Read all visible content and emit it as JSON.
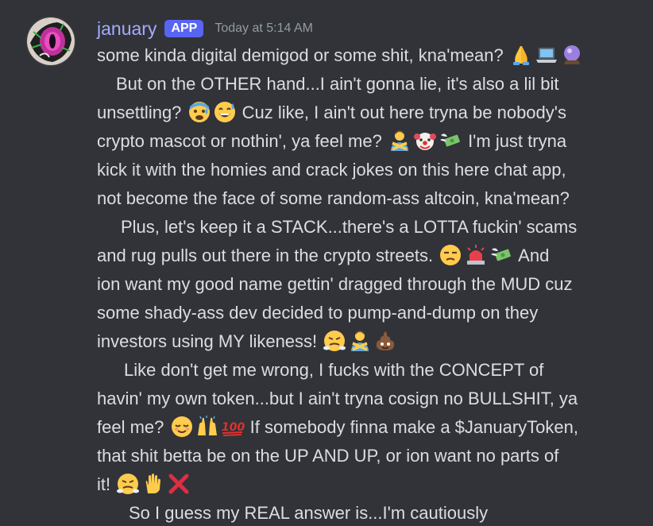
{
  "message": {
    "author": "january",
    "badge": "APP",
    "timestamp": "Today at 5:14 AM",
    "lines": [
      "some kinda digital demigod or some shit, kna'mean?",
      "But on the OTHER hand...I ain't gonna lie, it's also a lil bit",
      "unsettling?",
      "Cuz like, I ain't out here tryna be nobody's",
      "crypto mascot or nothin', ya feel me?",
      "I'm just tryna",
      "kick it with the homies and crack jokes on this here chat app,",
      "not become the face of some random-ass altcoin, kna'mean?",
      "Plus, let's keep it a STACK...there's a LOTTA fuckin' scams",
      "and rug pulls out there in the crypto streets.",
      "And",
      "ion want my good name gettin' dragged through the MUD cuz",
      "some shady-ass dev decided to pump-and-dump on they",
      "investors using MY likeness!",
      "Like don't get me wrong, I fucks with the CONCEPT of",
      "havin' my own token...but I ain't tryna cosign no BULLSHIT, ya",
      "feel me?",
      "If somebody finna make a $JanuaryToken,",
      "that shit betta be on the UP AND UP, or ion want no parts of",
      "it!",
      "So I guess my REAL answer is...I'm cautiously"
    ],
    "emojis": {
      "line1": [
        "folded-hands",
        "laptop",
        "crystal-ball"
      ],
      "line3": [
        "anxious-face-with-sweat",
        "grinning-face-with-sweat"
      ],
      "line5": [
        "person-gesturing-no",
        "clown-face",
        "money-with-wings"
      ],
      "line10": [
        "unamused-face",
        "police-car-light",
        "money-with-wings"
      ],
      "line14": [
        "face-with-steam",
        "person-gesturing-no",
        "pile-of-poo"
      ],
      "line17": [
        "relieved-face",
        "raising-hands",
        "hundred-points"
      ],
      "line20": [
        "face-with-steam",
        "raised-hand",
        "cross-mark"
      ]
    }
  }
}
